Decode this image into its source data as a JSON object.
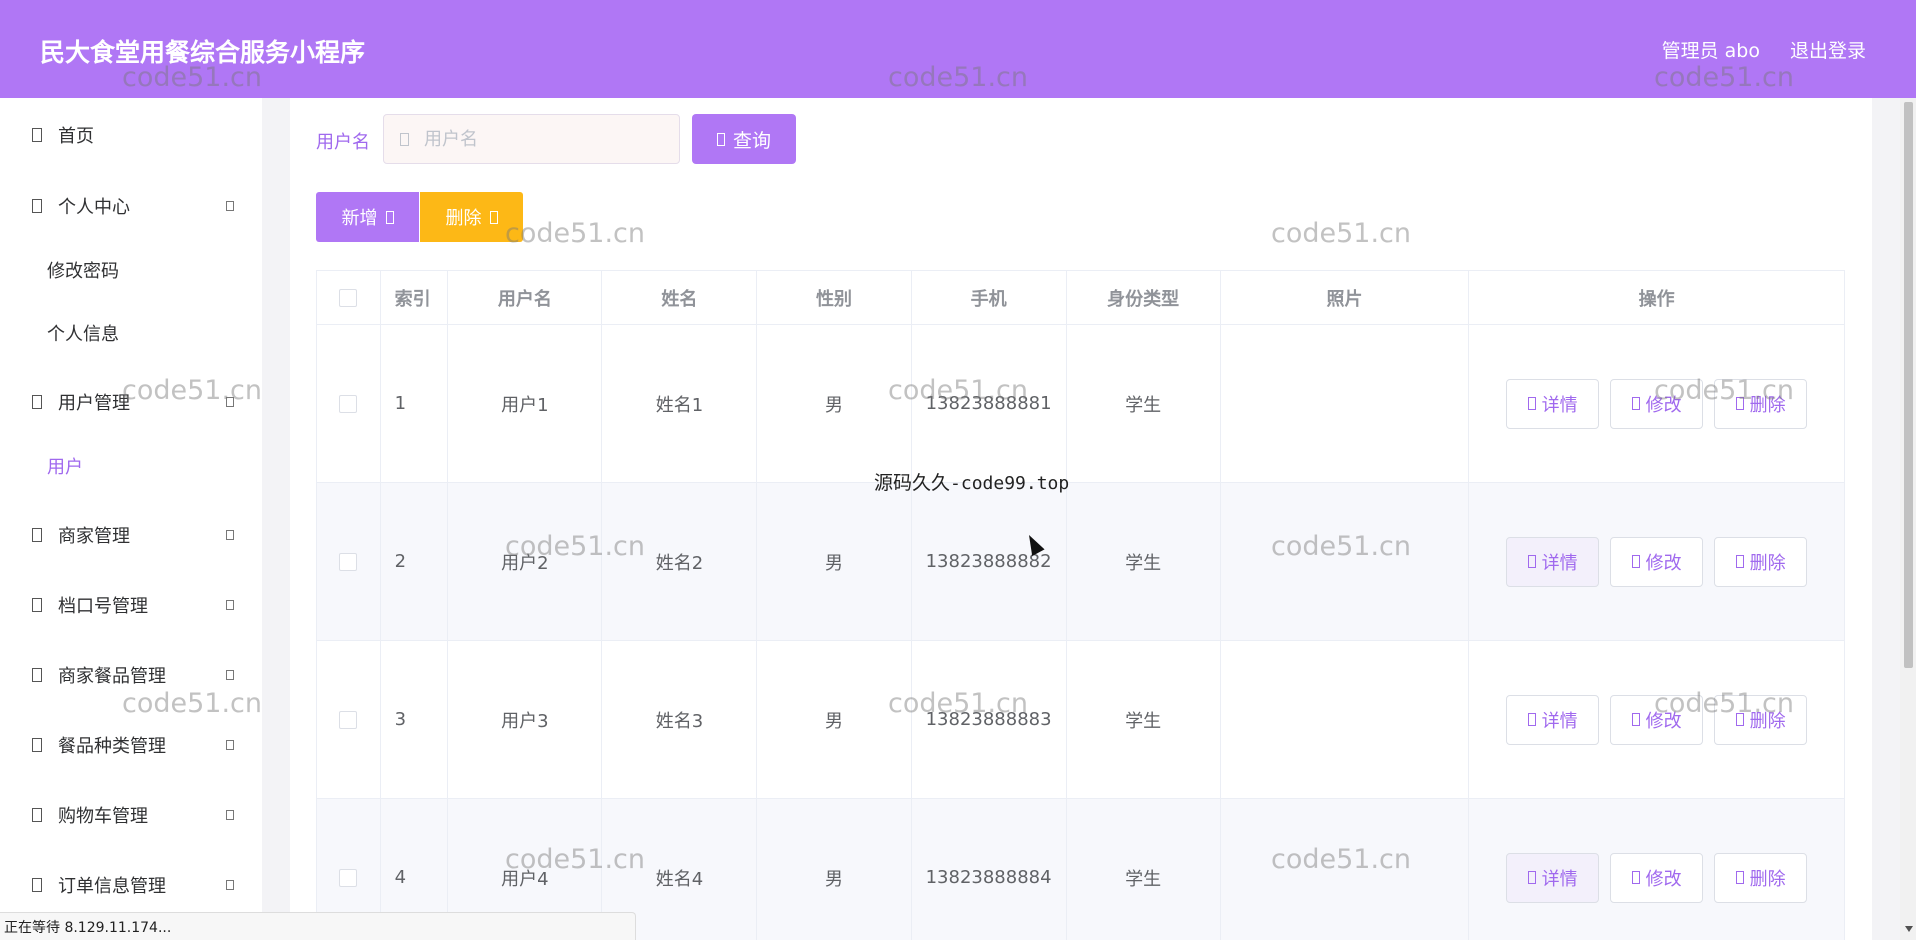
{
  "header": {
    "title": "民大食堂用餐综合服务小程序",
    "user": "管理员 abo",
    "logout": "退出登录",
    "bg_color": "#b077f5"
  },
  "sidebar": {
    "items": [
      {
        "label": "首页"
      },
      {
        "label": "个人中心"
      },
      {
        "label": "修改密码"
      },
      {
        "label": "个人信息"
      },
      {
        "label": "用户管理"
      },
      {
        "label": "用户"
      },
      {
        "label": "商家管理"
      },
      {
        "label": "档口号管理"
      },
      {
        "label": "商家餐品管理"
      },
      {
        "label": "餐品种类管理"
      },
      {
        "label": "购物车管理"
      },
      {
        "label": "订单信息管理"
      }
    ]
  },
  "search": {
    "label": "用户名",
    "placeholder": "用户名",
    "value": "",
    "query_label": "查询"
  },
  "actions": {
    "add_label": "新增",
    "delete_label": "删除"
  },
  "table": {
    "columns": [
      "索引",
      "用户名",
      "姓名",
      "性别",
      "手机",
      "身份类型",
      "照片",
      "操作"
    ],
    "rows": [
      {
        "index": "1",
        "username": "用户1",
        "name": "姓名1",
        "sex": "男",
        "phone": "13823888881",
        "type": "学生"
      },
      {
        "index": "2",
        "username": "用户2",
        "name": "姓名2",
        "sex": "男",
        "phone": "13823888882",
        "type": "学生"
      },
      {
        "index": "3",
        "username": "用户3",
        "name": "姓名3",
        "sex": "男",
        "phone": "13823888883",
        "type": "学生"
      },
      {
        "index": "4",
        "username": "用户4",
        "name": "姓名4",
        "sex": "男",
        "phone": "13823888884",
        "type": "学生"
      }
    ],
    "ops": {
      "detail": "详情",
      "edit": "修改",
      "delete": "删除"
    }
  },
  "watermark": {
    "text": "code51.cn",
    "center_cn": "源码久久",
    "center_en": "-code99.top"
  },
  "statusbar": {
    "text": "正在等待 8.129.11.174..."
  },
  "colors": {
    "accent": "#b077f5",
    "warning": "#fdb816",
    "link": "#a069ee"
  }
}
